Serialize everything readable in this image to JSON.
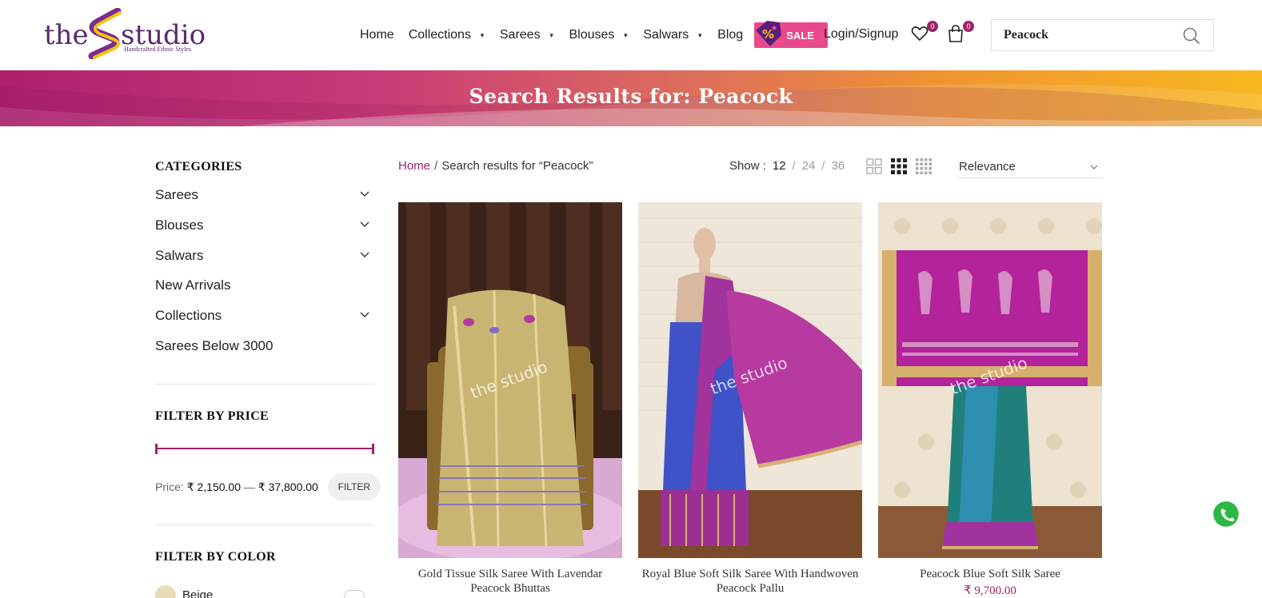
{
  "logo": {
    "brand_left": "the",
    "brand_right": "studio",
    "tagline": "Handcrafted Ethnic Styles"
  },
  "nav": {
    "items": [
      {
        "label": "Home",
        "has_dropdown": false
      },
      {
        "label": "Collections",
        "has_dropdown": true
      },
      {
        "label": "Sarees",
        "has_dropdown": true
      },
      {
        "label": "Blouses",
        "has_dropdown": true
      },
      {
        "label": "Salwars",
        "has_dropdown": true
      },
      {
        "label": "Blog",
        "has_dropdown": false
      }
    ],
    "sale": {
      "label": "SALE",
      "icon": "percent-tag-icon",
      "color": "#e94a8c"
    },
    "login_label": "Login/Signup",
    "wishlist": {
      "icon": "heart-icon",
      "count": "0"
    },
    "cart": {
      "icon": "shopping-bag-icon",
      "count": "0"
    }
  },
  "search": {
    "value": "Peacock",
    "icon": "search-icon"
  },
  "banner": {
    "title": "Search Results for: Peacock"
  },
  "sidebar": {
    "categories_heading": "CATEGORIES",
    "categories": [
      {
        "label": "Sarees",
        "expandable": true
      },
      {
        "label": "Blouses",
        "expandable": true
      },
      {
        "label": "Salwars",
        "expandable": true
      },
      {
        "label": "New Arrivals",
        "expandable": false
      },
      {
        "label": "Collections",
        "expandable": true
      },
      {
        "label": "Sarees Below 3000",
        "expandable": false
      }
    ],
    "price_heading": "FILTER BY PRICE",
    "price": {
      "label": "Price:",
      "min": "₹ 2,150.00",
      "dash": "—",
      "max": "₹ 37,800.00",
      "filter_label": "FILTER",
      "range_fraction": [
        0,
        1
      ]
    },
    "color_heading": "FILTER BY COLOR",
    "colors": [
      {
        "label": "Beige",
        "swatch": "#e8dcb8"
      }
    ]
  },
  "toolbar": {
    "breadcrumb": {
      "home": "Home",
      "separator": "/",
      "current": "Search results for “Peacock”"
    },
    "show_label": "Show :",
    "show_options": [
      "12",
      "24",
      "36"
    ],
    "show_active": "12",
    "separator": "/",
    "grid_views": [
      "grid-2-icon",
      "grid-3-icon",
      "grid-4-icon"
    ],
    "grid_active": "grid-3-icon",
    "sort_label": "Relevance"
  },
  "products": [
    {
      "title": "Gold Tissue Silk Saree With Lavendar Peacock Bhuttas",
      "price": ""
    },
    {
      "title": "Royal Blue Soft Silk Saree With Handwoven Peacock Pallu",
      "price": ""
    },
    {
      "title": "Peacock Blue Soft Silk Saree",
      "price": "₹ 9,700.00"
    }
  ],
  "watermark": {
    "left": "the",
    "right": "studio"
  },
  "colors": {
    "brand_purple": "#a0226b",
    "accent_pink": "#e94a8c",
    "logo_purple": "#5a2a6e",
    "whatsapp_green": "#2bb741"
  },
  "floating": {
    "whatsapp_icon": "whatsapp-icon"
  }
}
